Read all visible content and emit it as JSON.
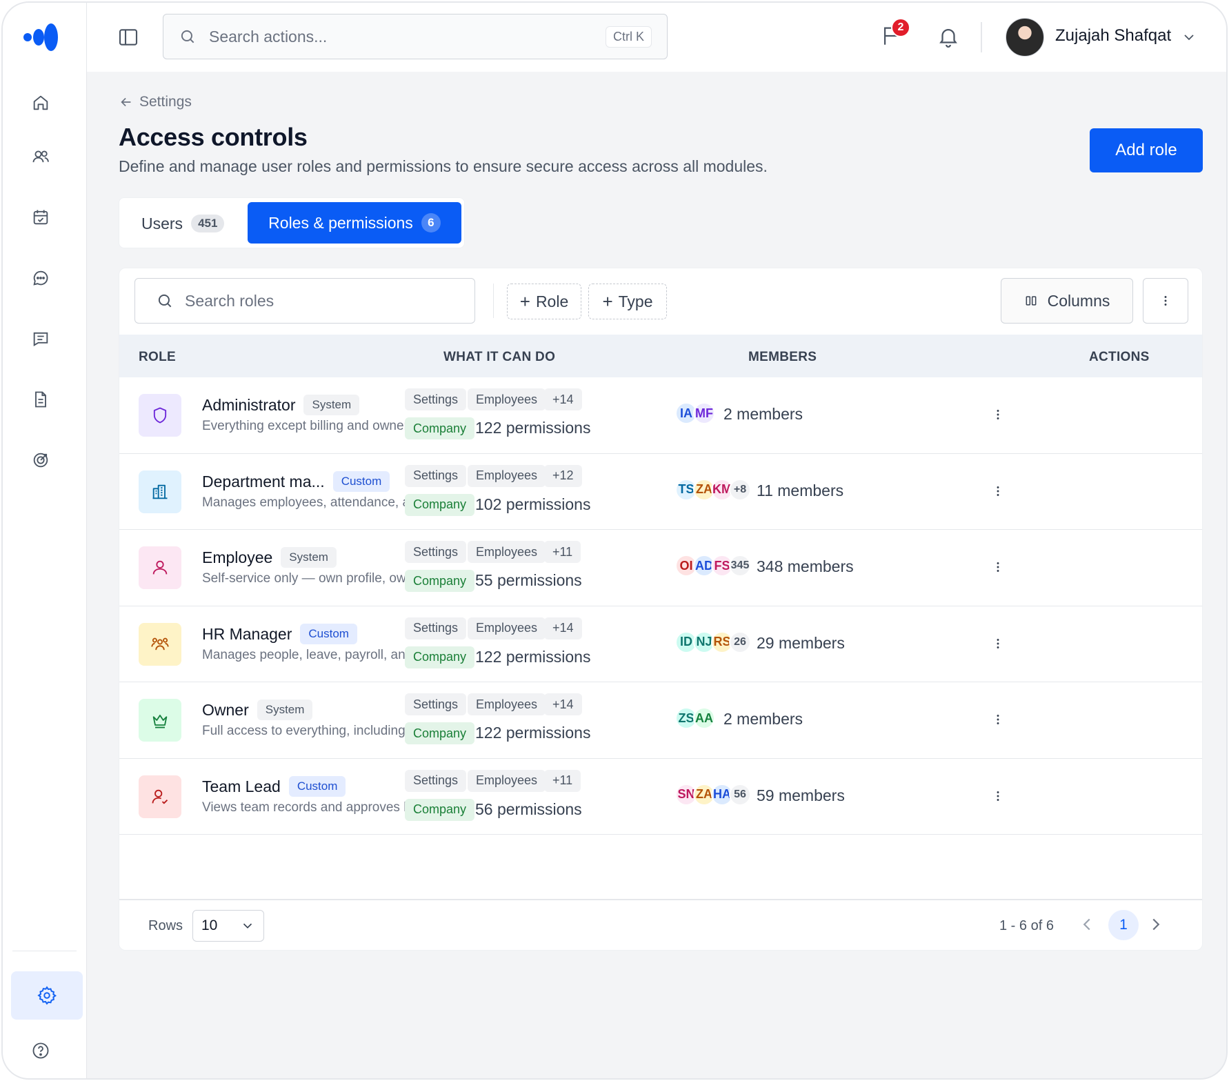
{
  "app": {
    "search_placeholder": "Search actions...",
    "search_shortcut": "Ctrl K",
    "notification_count": "2",
    "user_name": "Zujajah Shafqat"
  },
  "sidebar": {
    "items": [
      {
        "icon": "home-icon"
      },
      {
        "icon": "users-icon"
      },
      {
        "icon": "calendar-check-icon"
      },
      {
        "icon": "chat-icon"
      },
      {
        "icon": "message-square-icon"
      },
      {
        "icon": "document-icon"
      },
      {
        "icon": "target-icon"
      }
    ],
    "bottom": [
      {
        "icon": "settings-icon",
        "active": true
      },
      {
        "icon": "help-icon"
      }
    ]
  },
  "page": {
    "back_label": "Settings",
    "title": "Access controls",
    "subtitle": "Define and manage user roles and permissions to ensure secure access across all modules.",
    "primary_action": "Add role"
  },
  "tabs": [
    {
      "label": "Users",
      "count": "451",
      "active": false
    },
    {
      "label": "Roles & permissions",
      "count": "6",
      "active": true
    }
  ],
  "toolbar": {
    "search_placeholder": "Search roles",
    "filter_role": "Role",
    "filter_type": "Type",
    "columns_label": "Columns"
  },
  "table": {
    "headers": [
      "ROLE",
      "WHAT IT CAN DO",
      "MEMBERS",
      "ACTIONS"
    ],
    "rows": [
      {
        "name": "Administrator",
        "tag": "System",
        "desc": "Everything except billing and owners",
        "perms": [
          "Settings",
          "Employees",
          "+14",
          "Company"
        ],
        "perm_count": "122 permissions",
        "avatars": [
          "IA",
          "MF"
        ],
        "members": "2 members",
        "icon": "shield-icon",
        "icon_bg": "#ede9fe",
        "icon_color": "#6d28d9"
      },
      {
        "name": "Department ma...",
        "tag": "Custom",
        "desc": "Manages employees, attendance, an",
        "perms": [
          "Settings",
          "Employees",
          "+12",
          "Company"
        ],
        "perm_count": "102 permissions",
        "avatars": [
          "TS",
          "ZA",
          "KM",
          "+8"
        ],
        "members": "11 members",
        "icon": "building-icon",
        "icon_bg": "#e0f2fe",
        "icon_color": "#0369a1"
      },
      {
        "name": "Employee",
        "tag": "System",
        "desc": "Self-service only — own profile, own",
        "perms": [
          "Settings",
          "Employees",
          "+11",
          "Company"
        ],
        "perm_count": "55 permissions",
        "avatars": [
          "OI",
          "AD",
          "FS",
          "345"
        ],
        "members": "348 members",
        "icon": "user-icon",
        "icon_bg": "#fce7f3",
        "icon_color": "#be185d"
      },
      {
        "name": "HR Manager",
        "tag": "Custom",
        "desc": "Manages people, leave, payroll, and I",
        "perms": [
          "Settings",
          "Employees",
          "+14",
          "Company"
        ],
        "perm_count": "122 permissions",
        "avatars": [
          "ID",
          "NJ",
          "RS",
          "26"
        ],
        "members": "29 members",
        "icon": "group-icon",
        "icon_bg": "#fef3c7",
        "icon_color": "#b45309"
      },
      {
        "name": "Owner",
        "tag": "System",
        "desc": "Full access to everything, including b",
        "perms": [
          "Settings",
          "Employees",
          "+14",
          "Company"
        ],
        "perm_count": "122 permissions",
        "avatars": [
          "ZS",
          "AA"
        ],
        "members": "2 members",
        "icon": "crown-icon",
        "icon_bg": "#dcfce7",
        "icon_color": "#15803d"
      },
      {
        "name": "Team Lead",
        "tag": "Custom",
        "desc": "Views team records and approves lea",
        "perms": [
          "Settings",
          "Employees",
          "+11",
          "Company"
        ],
        "perm_count": "56 permissions",
        "avatars": [
          "SN",
          "ZA",
          "HA",
          "56"
        ],
        "members": "59 members",
        "icon": "user-check-icon",
        "icon_bg": "#fee2e2",
        "icon_color": "#b91c1c"
      }
    ]
  },
  "pagination": {
    "rows_label": "Rows",
    "rows_value": "10",
    "range": "1 - 6 of 6",
    "current_page": "1"
  },
  "colors": {
    "primary": "#0a5cf5",
    "badge_red": "#e11d2a"
  }
}
